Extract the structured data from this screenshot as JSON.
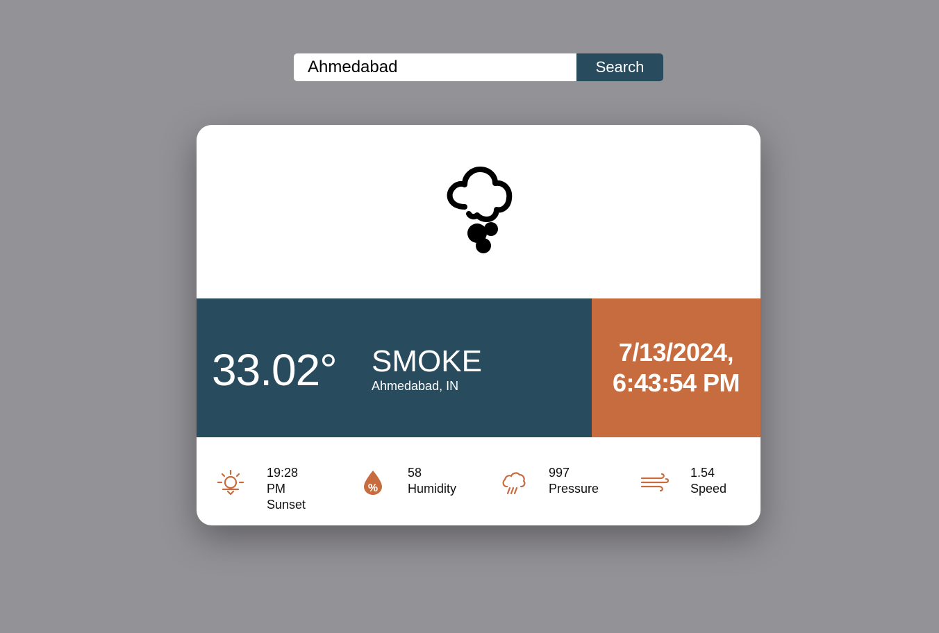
{
  "search": {
    "value": "Ahmedabad",
    "button_label": "Search"
  },
  "weather": {
    "icon": "smoke-cloud-icon",
    "temperature": "33.02°",
    "condition": "SMOKE",
    "location": "Ahmedabad, IN",
    "date": "7/13/2024,",
    "time": "6:43:54 PM"
  },
  "stats": [
    {
      "icon": "sunset-icon",
      "value": "19:28 PM",
      "label": "Sunset"
    },
    {
      "icon": "humidity-icon",
      "value": "58",
      "label": "Humidity"
    },
    {
      "icon": "pressure-icon",
      "value": "997",
      "label": "Pressure"
    },
    {
      "icon": "wind-icon",
      "value": "1.54",
      "label": "Speed"
    }
  ],
  "colors": {
    "background": "#939297",
    "primary": "#284b5e",
    "accent": "#c76c3f",
    "card": "#ffffff"
  }
}
